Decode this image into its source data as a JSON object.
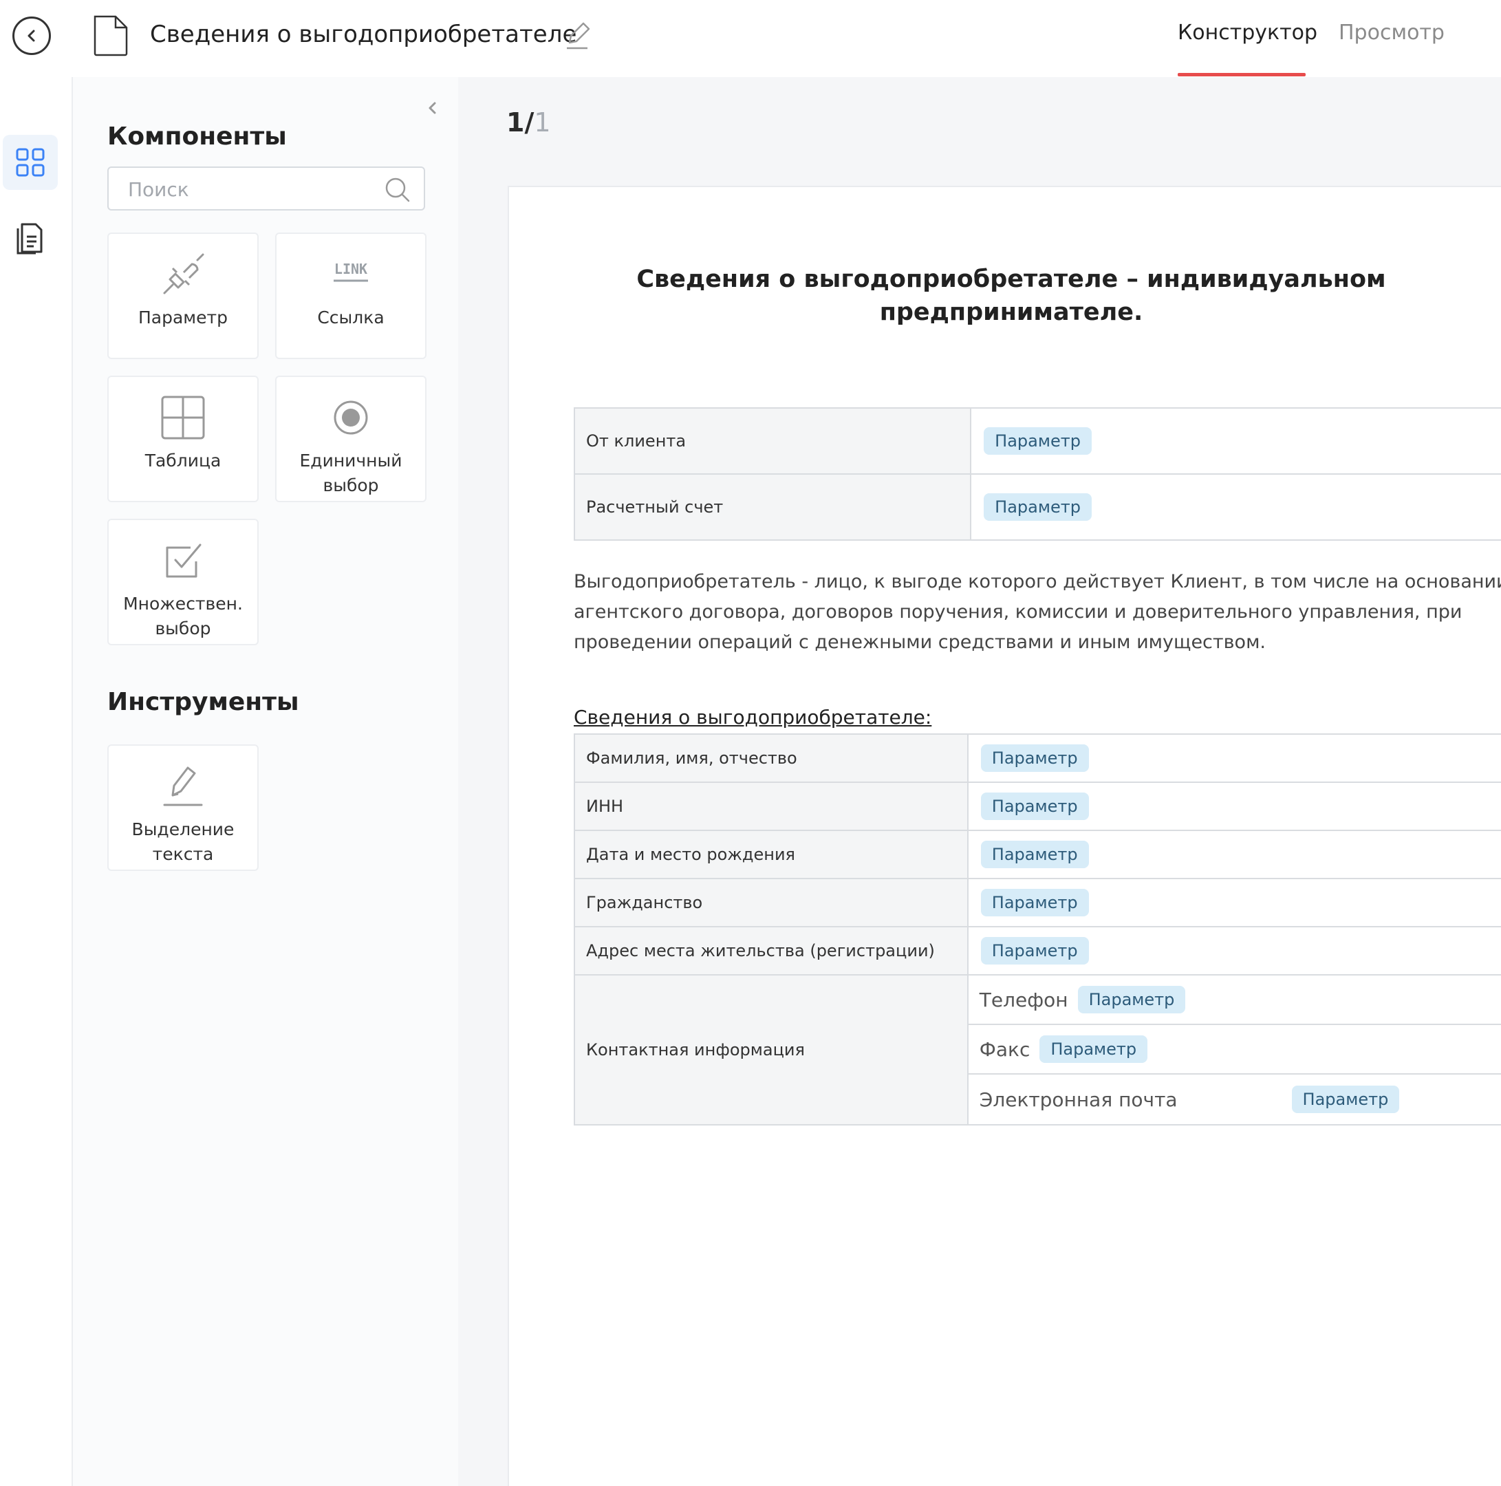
{
  "header": {
    "title": "Сведения о выгодоприобретателе",
    "tabs": [
      {
        "label": "Конструктор",
        "active": true
      },
      {
        "label": "Просмотр",
        "active": false
      }
    ],
    "accent_color": "#e74c4c"
  },
  "rail": {
    "items": [
      {
        "icon": "grid-icon",
        "active": true
      },
      {
        "icon": "documents-icon",
        "active": false
      }
    ]
  },
  "panel": {
    "components_heading": "Компоненты",
    "search_placeholder": "Поиск",
    "components": [
      {
        "icon": "plug-icon",
        "label": "Параметр"
      },
      {
        "icon": "link-icon",
        "icon_text": "LINK",
        "label": "Ссылка"
      },
      {
        "icon": "table-icon",
        "label": "Таблица"
      },
      {
        "icon": "radio-icon",
        "label": "Единичный\nвыбор"
      },
      {
        "icon": "checkbox-icon",
        "label": "Множествен.\nвыбор"
      }
    ],
    "tools_heading": "Инструменты",
    "tools": [
      {
        "icon": "highlighter-icon",
        "label": "Выделение\nтекста"
      }
    ]
  },
  "workspace": {
    "page_current": "1/",
    "page_total": "1",
    "document": {
      "title": "Сведения о выгодоприобретателе – индивидуальном предпринимателе.",
      "table1": [
        {
          "label": "От клиента",
          "chip": "Параметр"
        },
        {
          "label": "Расчетный счет",
          "chip": "Параметр"
        }
      ],
      "paragraph": "Выгодоприобретатель - лицо, к выгоде которого действует Клиент, в том числе на  основании агентского договора, договоров поручения, комиссии и доверительного управления, при проведении операций с денежными средствами и иным имуществом.",
      "section_heading": "Сведения о выгодоприобретателе:",
      "table2": [
        {
          "label": "Фамилия, имя, отчество",
          "chip": "Параметр"
        },
        {
          "label": "ИНН",
          "chip": "Параметр"
        },
        {
          "label": "Дата и место рождения",
          "chip": "Параметр"
        },
        {
          "label": "Гражданство",
          "chip": "Параметр"
        },
        {
          "label": "Адрес места жительства (регистрации)",
          "chip": "Параметр"
        }
      ],
      "contact": {
        "label": "Контактная информация",
        "rows": [
          {
            "label": "Телефон",
            "chip": "Параметр"
          },
          {
            "label": "Факс",
            "chip": "Параметр"
          },
          {
            "label": "Электронная почта",
            "chip": "Параметр"
          }
        ]
      }
    }
  }
}
